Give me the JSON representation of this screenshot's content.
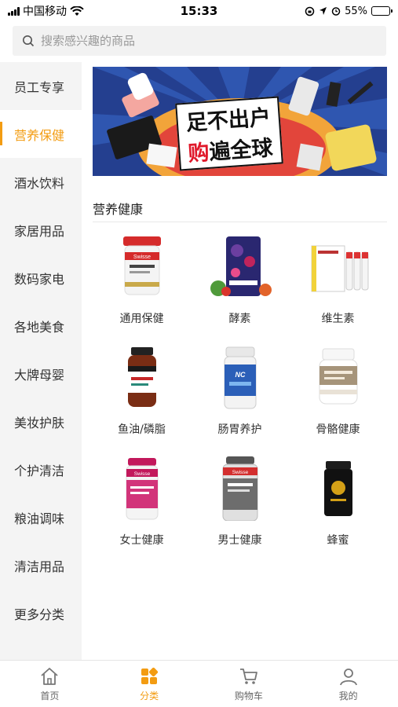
{
  "status_bar": {
    "carrier": "中国移动",
    "time": "15:33",
    "battery": "55%",
    "battery_level": 0.55
  },
  "search": {
    "placeholder": "搜索感兴趣的商品"
  },
  "sidebar": {
    "active_index": 1,
    "items": [
      {
        "label": "员工专享"
      },
      {
        "label": "营养保健"
      },
      {
        "label": "酒水饮料"
      },
      {
        "label": "家居用品"
      },
      {
        "label": "数码家电"
      },
      {
        "label": "各地美食"
      },
      {
        "label": "大牌母婴"
      },
      {
        "label": "美妆护肤"
      },
      {
        "label": "个护清洁"
      },
      {
        "label": "粮油调味"
      },
      {
        "label": "清洁用品"
      },
      {
        "label": "更多分类"
      }
    ]
  },
  "banner": {
    "line1_a": "足",
    "line1_b": "不出户",
    "line2_a": "购",
    "line2_b": "遍全球"
  },
  "section": {
    "title": "营养健康"
  },
  "products": [
    {
      "label": "通用保健",
      "icon": "swisse-jar-icon",
      "brand": "Swisse"
    },
    {
      "label": "酵素",
      "icon": "enzyme-pouch-icon"
    },
    {
      "label": "维生素",
      "icon": "vitamin-box-icon"
    },
    {
      "label": "鱼油/磷脂",
      "icon": "fish-oil-bottle-icon"
    },
    {
      "label": "肠胃养护",
      "icon": "probiotic-bottle-icon",
      "brand": "NC"
    },
    {
      "label": "骨骼健康",
      "icon": "bone-health-bottle-icon"
    },
    {
      "label": "女士健康",
      "icon": "women-health-bottle-icon",
      "brand": "Swisse"
    },
    {
      "label": "男士健康",
      "icon": "men-health-bottle-icon",
      "brand": "Swisse"
    },
    {
      "label": "蜂蜜",
      "icon": "honey-jar-icon"
    }
  ],
  "tabbar": {
    "active_index": 1,
    "tabs": [
      {
        "label": "首页",
        "icon": "home-icon"
      },
      {
        "label": "分类",
        "icon": "category-icon"
      },
      {
        "label": "购物车",
        "icon": "cart-icon"
      },
      {
        "label": "我的",
        "icon": "user-icon"
      }
    ]
  },
  "colors": {
    "accent": "#f39c12",
    "sidebar_bg": "#f4f4f4"
  }
}
